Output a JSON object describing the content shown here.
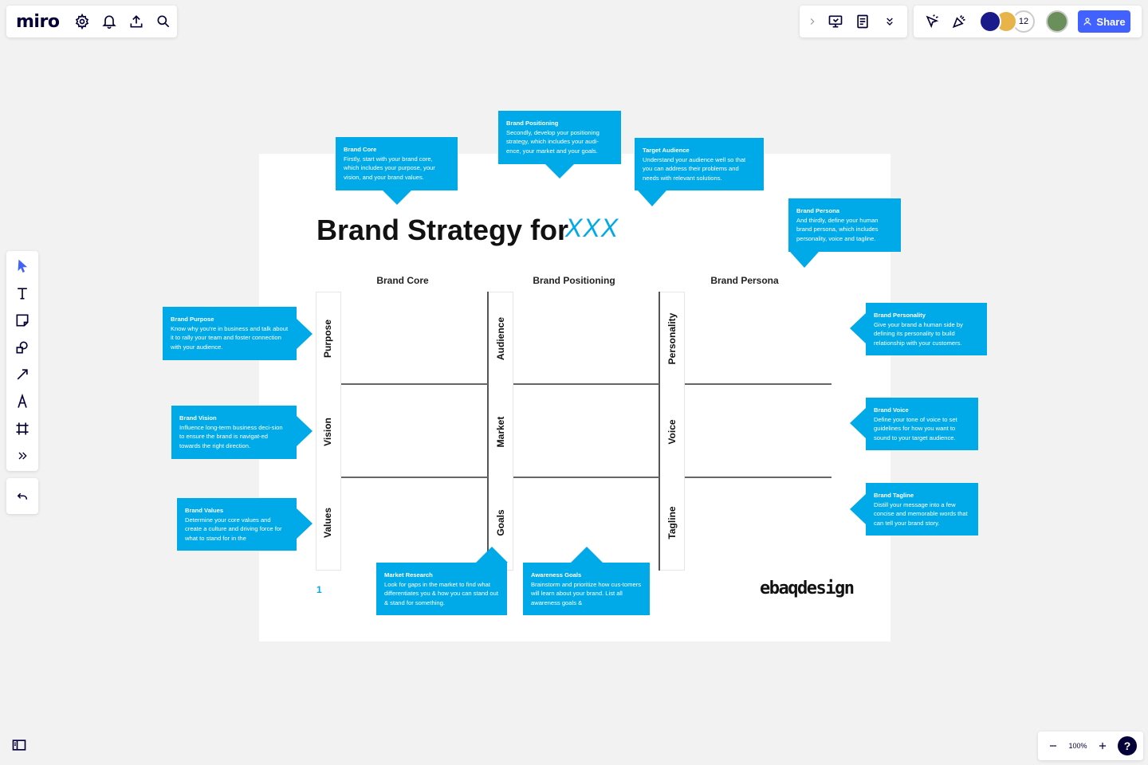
{
  "app": {
    "logo": "miro",
    "share_label": "Share",
    "collaborator_count": "12",
    "zoom_level": "100%",
    "help_label": "?",
    "accent_color": "#4262ff"
  },
  "board": {
    "title": "Brand Strategy for",
    "title_highlight": "XXX",
    "page_number": "1",
    "brand_logo": "ebaqdesign",
    "columns": [
      "Brand Core",
      "Brand Positioning",
      "Brand Persona"
    ],
    "rows": {
      "core": [
        "Purpose",
        "Vision",
        "Values"
      ],
      "positioning": [
        "Audience",
        "Market",
        "Goals"
      ],
      "persona": [
        "Personality",
        "Voice",
        "Tagline"
      ]
    },
    "callout_color": "#00a9e8"
  },
  "callouts": {
    "brand_core": {
      "title": "Brand Core",
      "body": "Firstly, start with your brand core, which includes your purpose, your vision, and your brand values."
    },
    "brand_positioning": {
      "title": "Brand Positioning",
      "body": "Secondly, develop your positioning strategy, which includes your audi-ence, your market and your goals."
    },
    "target_audience": {
      "title": "Target Audience",
      "body": "Understand your audience well so that you can address their problems and needs with relevant solutions."
    },
    "brand_persona": {
      "title": "Brand Persona",
      "body": "And thirdly, define your human brand persona, which includes personality, voice and tagline."
    },
    "brand_purpose": {
      "title": "Brand Purpose",
      "body": "Know why you're in business and talk about it to rally your team and foster connection with your audience."
    },
    "brand_vision": {
      "title": "Brand Vision",
      "body": "Influence long-term business deci-sion to ensure the brand is navigat-ed towards the right direction."
    },
    "brand_values": {
      "title": "Brand Values",
      "body": "Determine your core values and create a culture and driving force for what to stand for in the"
    },
    "brand_personality": {
      "title": "Brand Personality",
      "body": "Give your brand a human side by defining its personality to build relationship with your customers."
    },
    "brand_voice": {
      "title": "Brand Voice",
      "body": "Define your tone of voice to set guidelines for how you want to sound to your target audience."
    },
    "brand_tagline": {
      "title": "Brand Tagline",
      "body": "Distill your message into a few concise and memorable words that can tell your brand story."
    },
    "market_research": {
      "title": "Market Research",
      "body": "Look for gaps in the market to find what differentiates you & how you can stand out & stand for something."
    },
    "awareness_goals": {
      "title": "Awareness Goals",
      "body": "Brainstorm and prioritize how cus-tomers will learn about your brand. List all awareness goals &"
    }
  }
}
